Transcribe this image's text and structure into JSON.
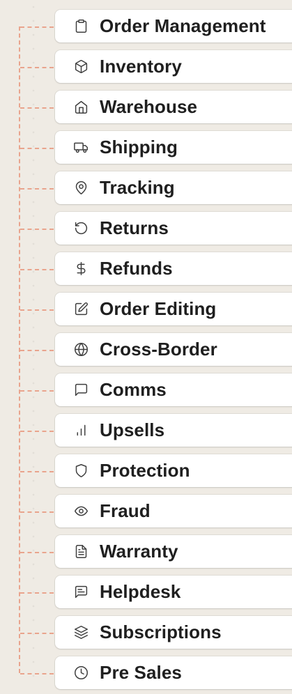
{
  "colors": {
    "background": "#efebe4",
    "connector": "#e9a48d",
    "card": "#ffffff",
    "text": "#1f1f1f"
  },
  "items": [
    {
      "label": "Order Management",
      "icon": "clipboard-icon"
    },
    {
      "label": "Inventory",
      "icon": "box-icon"
    },
    {
      "label": "Warehouse",
      "icon": "warehouse-icon"
    },
    {
      "label": "Shipping",
      "icon": "truck-icon"
    },
    {
      "label": "Tracking",
      "icon": "map-pin-icon"
    },
    {
      "label": "Returns",
      "icon": "rotate-ccw-icon"
    },
    {
      "label": "Refunds",
      "icon": "dollar-icon"
    },
    {
      "label": "Order Editing",
      "icon": "edit-icon"
    },
    {
      "label": "Cross-Border",
      "icon": "globe-icon"
    },
    {
      "label": "Comms",
      "icon": "message-square-icon"
    },
    {
      "label": "Upsells",
      "icon": "bar-chart-icon"
    },
    {
      "label": "Protection",
      "icon": "shield-icon"
    },
    {
      "label": "Fraud",
      "icon": "eye-icon"
    },
    {
      "label": "Warranty",
      "icon": "file-text-icon"
    },
    {
      "label": "Helpdesk",
      "icon": "message-square-text-icon"
    },
    {
      "label": "Subscriptions",
      "icon": "layers-icon"
    },
    {
      "label": "Pre Sales",
      "icon": "clock-icon"
    }
  ]
}
